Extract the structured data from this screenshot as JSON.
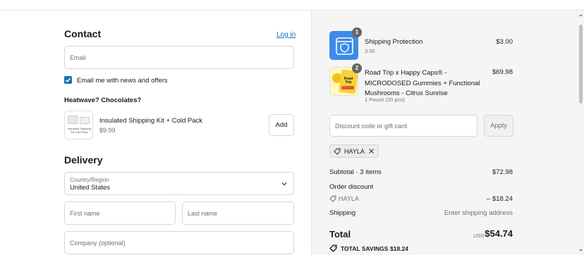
{
  "contact": {
    "heading": "Contact",
    "login_link": "Log in",
    "email_placeholder": "Email",
    "newsletter_label": "Email me with news and offers",
    "newsletter_checked": true
  },
  "upsell": {
    "heading": "Heatwave? Chocolates?",
    "product_name": "Insulated Shipping Kit + Cold Pack",
    "product_price": "$9.99",
    "add_label": "Add",
    "thumb_caption": "Insulated Shipping Kit Cold Pack"
  },
  "delivery": {
    "heading": "Delivery",
    "country_label": "Country/Region",
    "country_value": "United States",
    "first_name_placeholder": "First name",
    "last_name_placeholder": "Last name",
    "company_placeholder": "Company (optional)"
  },
  "cart": {
    "items": [
      {
        "qty": "1",
        "name": "Shipping Protection",
        "sub": "3.00",
        "price": "$3.00",
        "icon": "shield-icon"
      },
      {
        "qty": "2",
        "name": "Road Trip x Happy Caps® - MICRODOSED Gummies + Functional Mushrooms - Citrus Sunrise",
        "sub": "1 Pouch (20 pcs)",
        "price": "$69.98",
        "thumb_text": "Road Trip"
      }
    ],
    "discount_placeholder": "Discount code or gift card",
    "apply_label": "Apply",
    "applied_code": "HAYLA",
    "subtotal_label": "Subtotal · 3 items",
    "subtotal_value": "$72.98",
    "order_discount_label": "Order discount",
    "discount_code": "HAYLA",
    "discount_value": "– $18.24",
    "shipping_label": "Shipping",
    "shipping_value": "Enter shipping address",
    "total_label": "Total",
    "currency": "USD",
    "total_value": "$54.74",
    "savings_label": "TOTAL SAVINGS",
    "savings_value": "$18.24"
  },
  "colors": {
    "accent": "#1773b0",
    "shield_tile": "#3b8ce8"
  }
}
